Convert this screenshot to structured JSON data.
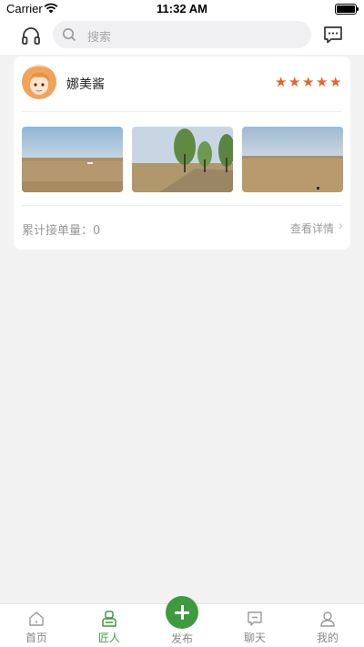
{
  "status": {
    "carrier": "Carrier",
    "time": "11:32 AM"
  },
  "search": {
    "placeholder": "搜索"
  },
  "card": {
    "username": "娜美酱",
    "rating": 5,
    "orders_label": "累计接单量：",
    "orders_count": "0",
    "details_label": "查看详情",
    "photos": [
      "river-photo-1",
      "river-photo-2",
      "river-photo-3"
    ]
  },
  "tabs": {
    "home": "首页",
    "craftsman": "匠人",
    "publish": "发布",
    "chat": "聊天",
    "mine": "我的"
  },
  "colors": {
    "accent": "#3d9b3d",
    "star": "#e8632a"
  }
}
